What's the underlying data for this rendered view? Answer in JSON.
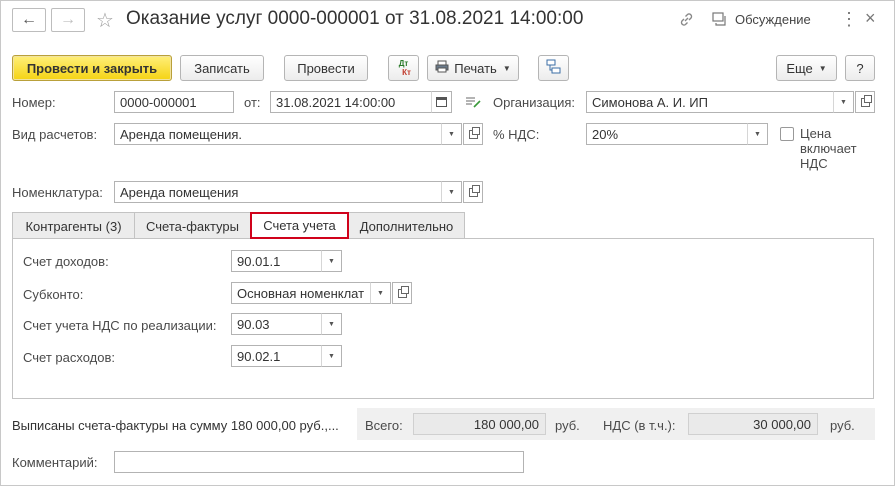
{
  "window": {
    "title": "Оказание услуг 0000-000001 от 31.08.2021 14:00:00",
    "discussion_label": "Обсуждение",
    "back_icon": "arrow-left-icon",
    "forward_icon": "arrow-right-icon",
    "star_icon": "star-icon",
    "link_icon": "link-icon",
    "menu_icon": "more-vertical-icon",
    "close_icon": "close-icon"
  },
  "toolbar": {
    "post_close_label": "Провести и закрыть",
    "save_label": "Записать",
    "post_label": "Провести",
    "dt_label": "Дт",
    "kt_label": "Кт",
    "print_label": "Печать",
    "more_label": "Еще",
    "help_label": "?"
  },
  "form": {
    "number_label": "Номер:",
    "number_value": "0000-000001",
    "date_label": "от:",
    "date_value": "31.08.2021 14:00:00",
    "org_label": "Организация:",
    "org_value": "Симонова А. И. ИП",
    "calc_type_label": "Вид расчетов:",
    "calc_type_value": "Аренда помещения.",
    "vat_label": "% НДС:",
    "vat_value": "20%",
    "price_incl_vat_line1": "Цена",
    "price_incl_vat_line2": "включает",
    "price_incl_vat_line3": "НДС",
    "nomenclature_label": "Номенклатура:",
    "nomenclature_value": "Аренда помещения"
  },
  "tabs": [
    {
      "label": "Контрагенты (3)"
    },
    {
      "label": "Счета-фактуры"
    },
    {
      "label": "Счета учета"
    },
    {
      "label": "Дополнительно"
    }
  ],
  "accounts": {
    "income_label": "Счет доходов:",
    "income_value": "90.01.1",
    "subconto_label": "Субконто:",
    "subconto_value": "Основная номенклат",
    "vat_sales_label": "Счет учета НДС по реализации:",
    "vat_sales_value": "90.03",
    "expense_label": "Счет расходов:",
    "expense_value": "90.02.1"
  },
  "footer": {
    "invoices_text": "Выписаны счета-фактуры на сумму 180 000,00 руб.,...",
    "total_label": "Всего:",
    "total_value": "180 000,00",
    "currency_1": "руб.",
    "vat_incl_label": "НДС (в т.ч.):",
    "vat_incl_value": "30 000,00",
    "currency_2": "руб.",
    "comment_label": "Комментарий:",
    "comment_value": ""
  },
  "colors": {
    "primary_button": "#f5d313",
    "active_tab_outline": "#d0021b"
  }
}
